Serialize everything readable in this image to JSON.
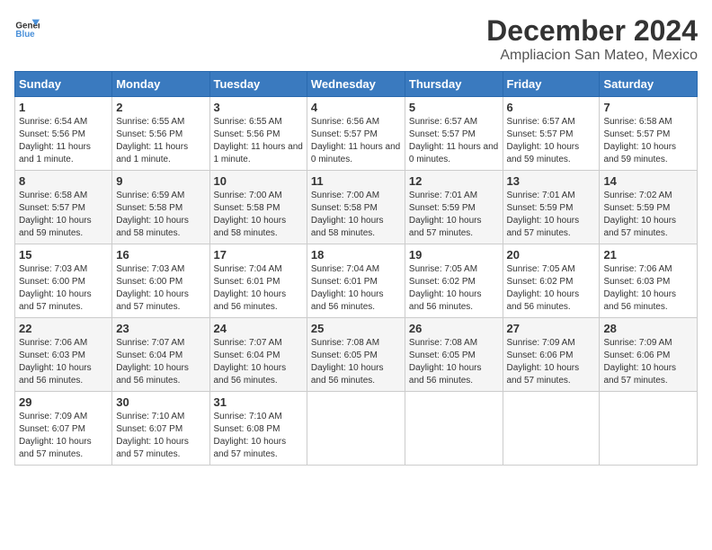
{
  "header": {
    "logo_general": "General",
    "logo_blue": "Blue",
    "month_title": "December 2024",
    "location": "Ampliacion San Mateo, Mexico"
  },
  "calendar": {
    "days_of_week": [
      "Sunday",
      "Monday",
      "Tuesday",
      "Wednesday",
      "Thursday",
      "Friday",
      "Saturday"
    ],
    "weeks": [
      [
        {
          "day": "1",
          "sunrise": "6:54 AM",
          "sunset": "5:56 PM",
          "daylight": "11 hours and 1 minute."
        },
        {
          "day": "2",
          "sunrise": "6:55 AM",
          "sunset": "5:56 PM",
          "daylight": "11 hours and 1 minute."
        },
        {
          "day": "3",
          "sunrise": "6:55 AM",
          "sunset": "5:56 PM",
          "daylight": "11 hours and 1 minute."
        },
        {
          "day": "4",
          "sunrise": "6:56 AM",
          "sunset": "5:57 PM",
          "daylight": "11 hours and 0 minutes."
        },
        {
          "day": "5",
          "sunrise": "6:57 AM",
          "sunset": "5:57 PM",
          "daylight": "11 hours and 0 minutes."
        },
        {
          "day": "6",
          "sunrise": "6:57 AM",
          "sunset": "5:57 PM",
          "daylight": "10 hours and 59 minutes."
        },
        {
          "day": "7",
          "sunrise": "6:58 AM",
          "sunset": "5:57 PM",
          "daylight": "10 hours and 59 minutes."
        }
      ],
      [
        {
          "day": "8",
          "sunrise": "6:58 AM",
          "sunset": "5:57 PM",
          "daylight": "10 hours and 59 minutes."
        },
        {
          "day": "9",
          "sunrise": "6:59 AM",
          "sunset": "5:58 PM",
          "daylight": "10 hours and 58 minutes."
        },
        {
          "day": "10",
          "sunrise": "7:00 AM",
          "sunset": "5:58 PM",
          "daylight": "10 hours and 58 minutes."
        },
        {
          "day": "11",
          "sunrise": "7:00 AM",
          "sunset": "5:58 PM",
          "daylight": "10 hours and 58 minutes."
        },
        {
          "day": "12",
          "sunrise": "7:01 AM",
          "sunset": "5:59 PM",
          "daylight": "10 hours and 57 minutes."
        },
        {
          "day": "13",
          "sunrise": "7:01 AM",
          "sunset": "5:59 PM",
          "daylight": "10 hours and 57 minutes."
        },
        {
          "day": "14",
          "sunrise": "7:02 AM",
          "sunset": "5:59 PM",
          "daylight": "10 hours and 57 minutes."
        }
      ],
      [
        {
          "day": "15",
          "sunrise": "7:03 AM",
          "sunset": "6:00 PM",
          "daylight": "10 hours and 57 minutes."
        },
        {
          "day": "16",
          "sunrise": "7:03 AM",
          "sunset": "6:00 PM",
          "daylight": "10 hours and 57 minutes."
        },
        {
          "day": "17",
          "sunrise": "7:04 AM",
          "sunset": "6:01 PM",
          "daylight": "10 hours and 56 minutes."
        },
        {
          "day": "18",
          "sunrise": "7:04 AM",
          "sunset": "6:01 PM",
          "daylight": "10 hours and 56 minutes."
        },
        {
          "day": "19",
          "sunrise": "7:05 AM",
          "sunset": "6:02 PM",
          "daylight": "10 hours and 56 minutes."
        },
        {
          "day": "20",
          "sunrise": "7:05 AM",
          "sunset": "6:02 PM",
          "daylight": "10 hours and 56 minutes."
        },
        {
          "day": "21",
          "sunrise": "7:06 AM",
          "sunset": "6:03 PM",
          "daylight": "10 hours and 56 minutes."
        }
      ],
      [
        {
          "day": "22",
          "sunrise": "7:06 AM",
          "sunset": "6:03 PM",
          "daylight": "10 hours and 56 minutes."
        },
        {
          "day": "23",
          "sunrise": "7:07 AM",
          "sunset": "6:04 PM",
          "daylight": "10 hours and 56 minutes."
        },
        {
          "day": "24",
          "sunrise": "7:07 AM",
          "sunset": "6:04 PM",
          "daylight": "10 hours and 56 minutes."
        },
        {
          "day": "25",
          "sunrise": "7:08 AM",
          "sunset": "6:05 PM",
          "daylight": "10 hours and 56 minutes."
        },
        {
          "day": "26",
          "sunrise": "7:08 AM",
          "sunset": "6:05 PM",
          "daylight": "10 hours and 56 minutes."
        },
        {
          "day": "27",
          "sunrise": "7:09 AM",
          "sunset": "6:06 PM",
          "daylight": "10 hours and 57 minutes."
        },
        {
          "day": "28",
          "sunrise": "7:09 AM",
          "sunset": "6:06 PM",
          "daylight": "10 hours and 57 minutes."
        }
      ],
      [
        {
          "day": "29",
          "sunrise": "7:09 AM",
          "sunset": "6:07 PM",
          "daylight": "10 hours and 57 minutes."
        },
        {
          "day": "30",
          "sunrise": "7:10 AM",
          "sunset": "6:07 PM",
          "daylight": "10 hours and 57 minutes."
        },
        {
          "day": "31",
          "sunrise": "7:10 AM",
          "sunset": "6:08 PM",
          "daylight": "10 hours and 57 minutes."
        },
        null,
        null,
        null,
        null
      ]
    ]
  }
}
